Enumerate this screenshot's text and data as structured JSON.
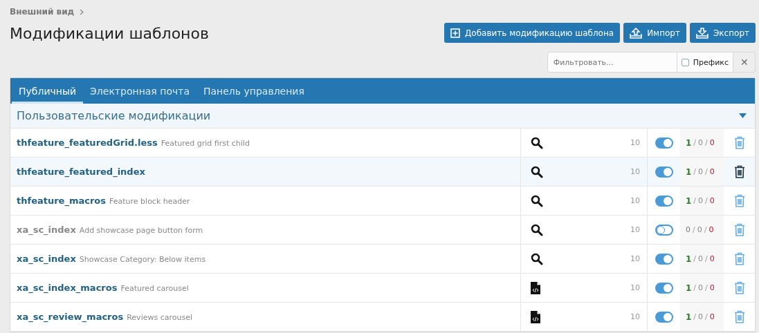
{
  "breadcrumb": [
    {
      "label": "Внешний вид"
    }
  ],
  "title": "Модификации шаблонов",
  "actions": [
    {
      "kind": "add",
      "label": "Добавить модификацию шаблона"
    },
    {
      "kind": "import",
      "label": "Импорт"
    },
    {
      "kind": "export",
      "label": "Экспорт"
    }
  ],
  "filter": {
    "placeholder": "Фильтровать...",
    "prefix_label": "Префикс",
    "prefix_checked": false,
    "clear": "✕"
  },
  "tabs": [
    {
      "label": "Публичный",
      "selected": true
    },
    {
      "label": "Электронная почта",
      "selected": false
    },
    {
      "label": "Панель управления",
      "selected": false
    }
  ],
  "count_separator": "/",
  "section": {
    "title": "Пользовательские модификации",
    "expanded": true
  },
  "rows": [
    {
      "name": "thfeature_featuredGrid.less",
      "description": "Featured grid first child",
      "kind": "search",
      "order": "10",
      "enabled": true,
      "highlighted": false,
      "ok": "1",
      "warn": "0",
      "error": "0"
    },
    {
      "name": "thfeature_featured_index",
      "kind": "search",
      "order": "10",
      "enabled": true,
      "highlighted": true,
      "ok": "1",
      "warn": "0",
      "error": "0"
    },
    {
      "name": "thfeature_macros",
      "description": "Feature block header",
      "kind": "search",
      "order": "10",
      "enabled": true,
      "highlighted": false,
      "ok": "1",
      "warn": "0",
      "error": "0"
    },
    {
      "name": "xa_sc_index",
      "description": "Add showcase page button form",
      "kind": "search",
      "order": "10",
      "enabled": false,
      "highlighted": false,
      "ok": "0",
      "warn": "0",
      "error": "0"
    },
    {
      "name": "xa_sc_index",
      "description": "Showcase Category: Below items",
      "kind": "search",
      "order": "10",
      "enabled": true,
      "highlighted": false,
      "ok": "1",
      "warn": "0",
      "error": "0"
    },
    {
      "name": "xa_sc_index_macros",
      "description": "Featured carousel",
      "kind": "code",
      "order": "10",
      "enabled": true,
      "highlighted": false,
      "ok": "1",
      "warn": "0",
      "error": "0"
    },
    {
      "name": "xa_sc_review_macros",
      "description": "Reviews carousel",
      "kind": "code",
      "order": "10",
      "enabled": true,
      "highlighted": false,
      "ok": "1",
      "warn": "0",
      "error": "0"
    }
  ]
}
